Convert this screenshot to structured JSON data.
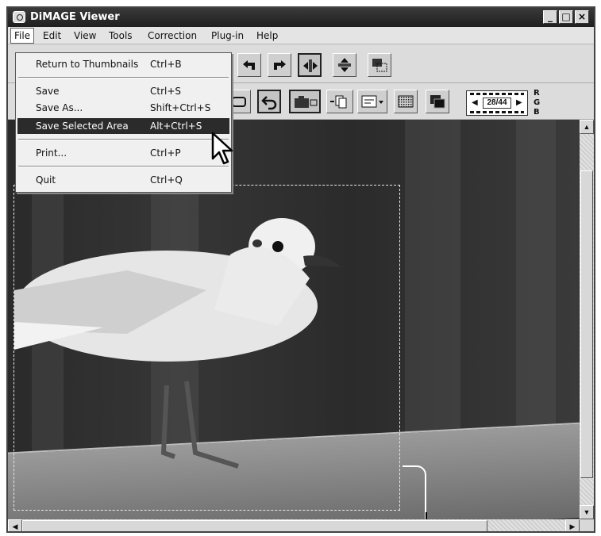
{
  "window": {
    "title": "DiMAGE Viewer",
    "controls": {
      "minimize": "_",
      "maximize": "□",
      "close": "×"
    }
  },
  "menubar": {
    "items": [
      "File",
      "Edit",
      "View",
      "Tools",
      "Correction",
      "Plug-in",
      "Help"
    ],
    "open_menu": "File"
  },
  "file_menu": {
    "items": [
      {
        "label": "Return to Thumbnails",
        "shortcut": "Ctrl+B"
      },
      {
        "label": "Save",
        "shortcut": "Ctrl+S"
      },
      {
        "label": "Save As...",
        "shortcut": "Shift+Ctrl+S"
      },
      {
        "label": "Save Selected Area",
        "shortcut": "Alt+Ctrl+S",
        "selected": true
      },
      {
        "label": "Print...",
        "shortcut": "Ctrl+P"
      },
      {
        "label": "Quit",
        "shortcut": "Ctrl+Q"
      }
    ]
  },
  "toolbar": {
    "row1_icons": [
      "rotate-left-icon",
      "rotate-right-icon",
      "flip-horizontal-icon",
      "flip-vertical-icon",
      "transform-icon"
    ],
    "row2_icons": [
      "crop-icon",
      "undo-icon",
      "camera-icon",
      "copy-icon",
      "layout-icon",
      "effects-icon",
      "compare-icon"
    ],
    "frame_counter": "28/44",
    "rgb_labels": [
      "R",
      "G",
      "B"
    ]
  },
  "colors": {
    "titlebar": "#2b2b2b",
    "menu_highlight": "#2b2b2b",
    "window_bg": "#d8d8d8"
  }
}
